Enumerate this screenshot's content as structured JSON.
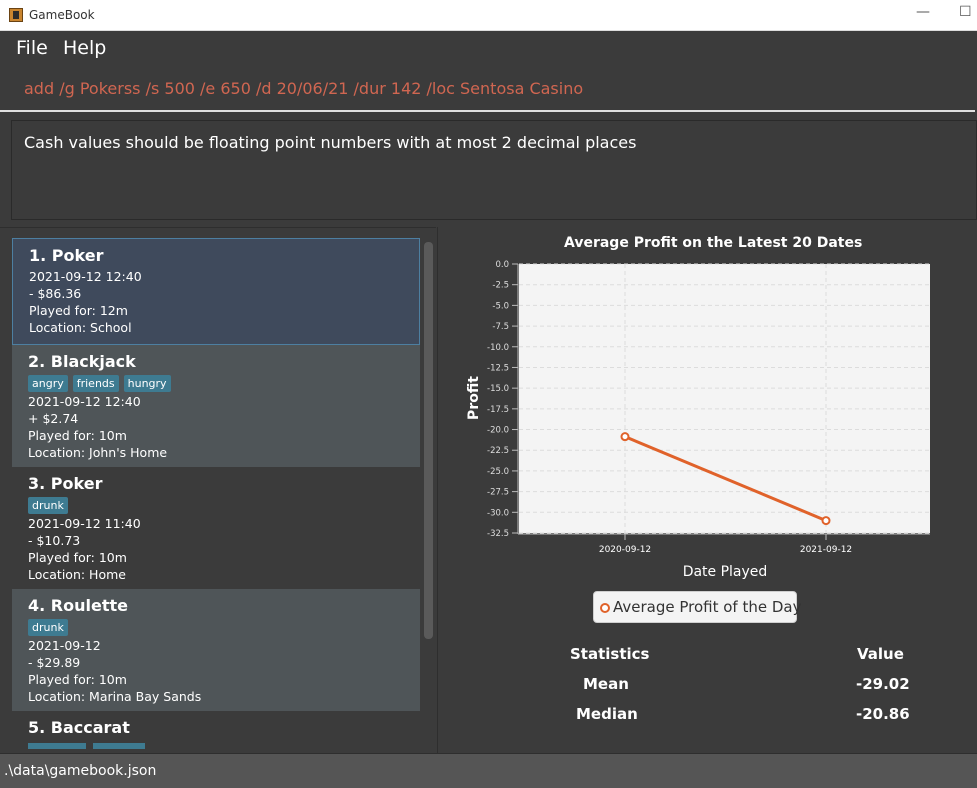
{
  "window": {
    "title": "GameBook",
    "minimize_glyph": "—",
    "maximize_glyph": "☐"
  },
  "menu": {
    "file": "File",
    "help": "Help"
  },
  "command": {
    "value": "add /g Pokerss /s 500 /e 650 /d 20/06/21 /dur 142 /loc Sentosa Casino"
  },
  "result": {
    "message": "Cash values should be floating point numbers with at most 2 decimal places"
  },
  "games": [
    {
      "title": "1.  Poker",
      "tags": [],
      "datetime": "2021-09-12 12:40",
      "profit": "- $86.36",
      "duration": "Played for: 12m",
      "location": "Location: School"
    },
    {
      "title": "2.  Blackjack",
      "tags": [
        "angry",
        "friends",
        "hungry"
      ],
      "datetime": "2021-09-12 12:40",
      "profit": "+ $2.74",
      "duration": "Played for: 10m",
      "location": "Location: John's Home"
    },
    {
      "title": "3.  Poker",
      "tags": [
        "drunk"
      ],
      "datetime": "2021-09-12 11:40",
      "profit": "- $10.73",
      "duration": "Played for: 10m",
      "location": "Location: Home"
    },
    {
      "title": "4.  Roulette",
      "tags": [
        "drunk"
      ],
      "datetime": "2021-09-12",
      "profit": "- $29.89",
      "duration": "Played for: 10m",
      "location": "Location: Marina Bay Sands"
    },
    {
      "title": "5.  Baccarat"
    }
  ],
  "chart_data": {
    "type": "line",
    "title": "Average Profit on the Latest 20 Dates",
    "xlabel": "Date Played",
    "ylabel": "Profit",
    "x": [
      "2020-09-12",
      "2021-09-12"
    ],
    "series": [
      {
        "name": "Average Profit of the Day",
        "values": [
          -20.86,
          -31.0
        ],
        "color": "#e0622a"
      }
    ],
    "ylim": [
      -32.5,
      0.0
    ],
    "yticks": [
      "0.0",
      "-2.5",
      "-5.0",
      "-7.5",
      "-10.0",
      "-12.5",
      "-15.0",
      "-17.5",
      "-20.0",
      "-22.5",
      "-25.0",
      "-27.5",
      "-30.0",
      "-32.5"
    ],
    "grid": true,
    "legend": "bottom"
  },
  "statistics": {
    "header_stat": "Statistics",
    "header_value": "Value",
    "rows": [
      {
        "name": "Mean",
        "value": "-29.02"
      },
      {
        "name": "Median",
        "value": "-20.86"
      }
    ]
  },
  "status": {
    "path": ".\\data\\gamebook.json"
  },
  "colors": {
    "accent": "#e0622a",
    "tag": "#3e7b91",
    "error_text": "#d06651"
  }
}
